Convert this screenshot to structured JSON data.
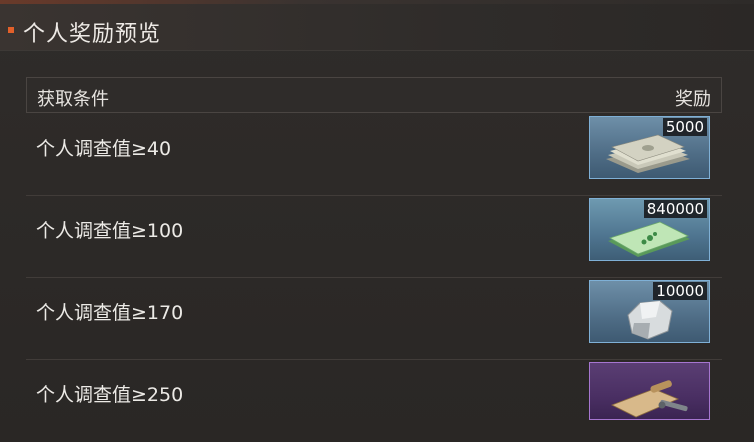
{
  "title": "个人奖励预览",
  "table": {
    "header_condition": "获取条件",
    "header_reward": "奖励",
    "rows": [
      {
        "condition": "个人调查值≥40",
        "reward_qty": "5000",
        "reward_icon": "cash-stack-icon",
        "frame": "blue"
      },
      {
        "condition": "个人调查值≥100",
        "reward_qty": "840000",
        "reward_icon": "green-banknote-icon",
        "frame": "blue"
      },
      {
        "condition": "个人调查值≥170",
        "reward_qty": "10000",
        "reward_icon": "silver-ore-icon",
        "frame": "blue"
      },
      {
        "condition": "个人调查值≥250",
        "reward_qty": "",
        "reward_icon": "blueprint-scroll-icon",
        "frame": "purple"
      }
    ]
  },
  "colors": {
    "accent": "#e2602a",
    "frame_blue": "#7fb0d6",
    "frame_purple": "#a676d0",
    "background": "#2a2725"
  }
}
